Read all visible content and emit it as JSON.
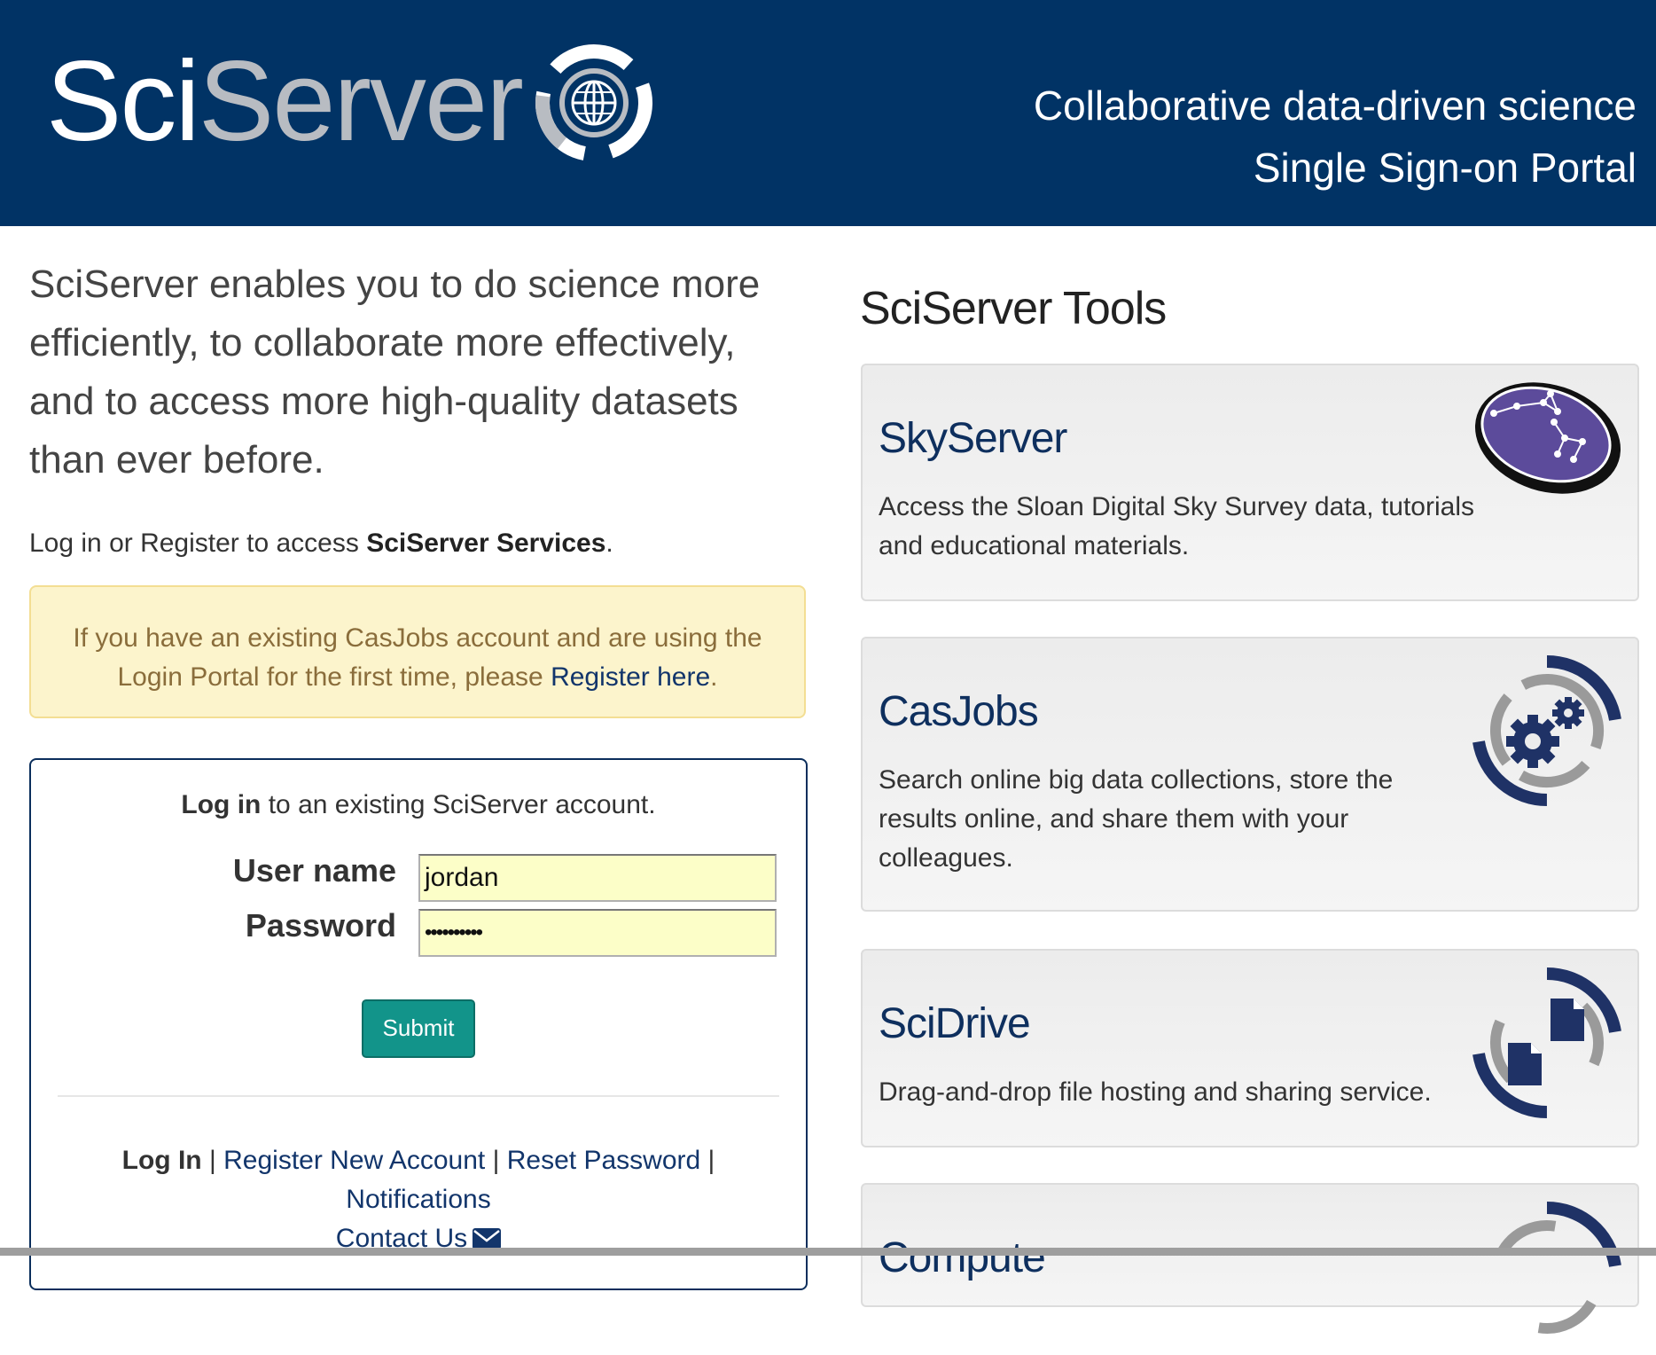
{
  "header": {
    "logo_sci": "Sci",
    "logo_server": "Server",
    "tagline_line1": "Collaborative data-driven science",
    "tagline_line2": "Single Sign-on Portal"
  },
  "intro": {
    "text": "SciServer enables you to do science more efficiently, to collaborate more effectively, and to access more high-quality datasets than ever before.",
    "login_note_prefix": "Log in or Register to access ",
    "login_note_bold": "SciServer Services",
    "login_note_suffix": "."
  },
  "alert": {
    "text_line1": "If you have an existing CasJobs account and are using the",
    "text_line2": "Login Portal for the first time, please ",
    "link": "Register here",
    "suffix": "."
  },
  "login": {
    "prompt_bold": "Log in",
    "prompt_rest": " to an existing SciServer account.",
    "username_label": "User name",
    "username_value": "jordan",
    "password_label": "Password",
    "password_value": "••••••••••",
    "submit_label": "Submit",
    "links": {
      "login": "Log In",
      "register": "Register New Account",
      "reset": "Reset Password",
      "notifications": "Notifications",
      "contact": "Contact Us",
      "separator": "|"
    }
  },
  "tools": {
    "title": "SciServer  Tools",
    "items": [
      {
        "name": "SkyServer",
        "desc_line1": "Access the Sloan Digital Sky Survey data, tutorials",
        "desc_line2": "and educational materials.",
        "icon": "constellation-icon"
      },
      {
        "name": "CasJobs",
        "desc_line1": "Search online big data collections, store the",
        "desc_line2": "results online, and share them with your",
        "desc_line3": "colleagues.",
        "icon": "gears-icon"
      },
      {
        "name": "SciDrive",
        "desc_line1": "Drag-and-drop file hosting and sharing service.",
        "icon": "files-icon"
      },
      {
        "name": "Compute",
        "icon": "compute-icon"
      }
    ]
  },
  "colors": {
    "header_bg": "#013365",
    "brand_gray": "#b8bcc2",
    "link": "#12356b",
    "submit": "#12948a",
    "alert_bg": "#fcf4cc",
    "tool_name": "#0e2f5e"
  }
}
